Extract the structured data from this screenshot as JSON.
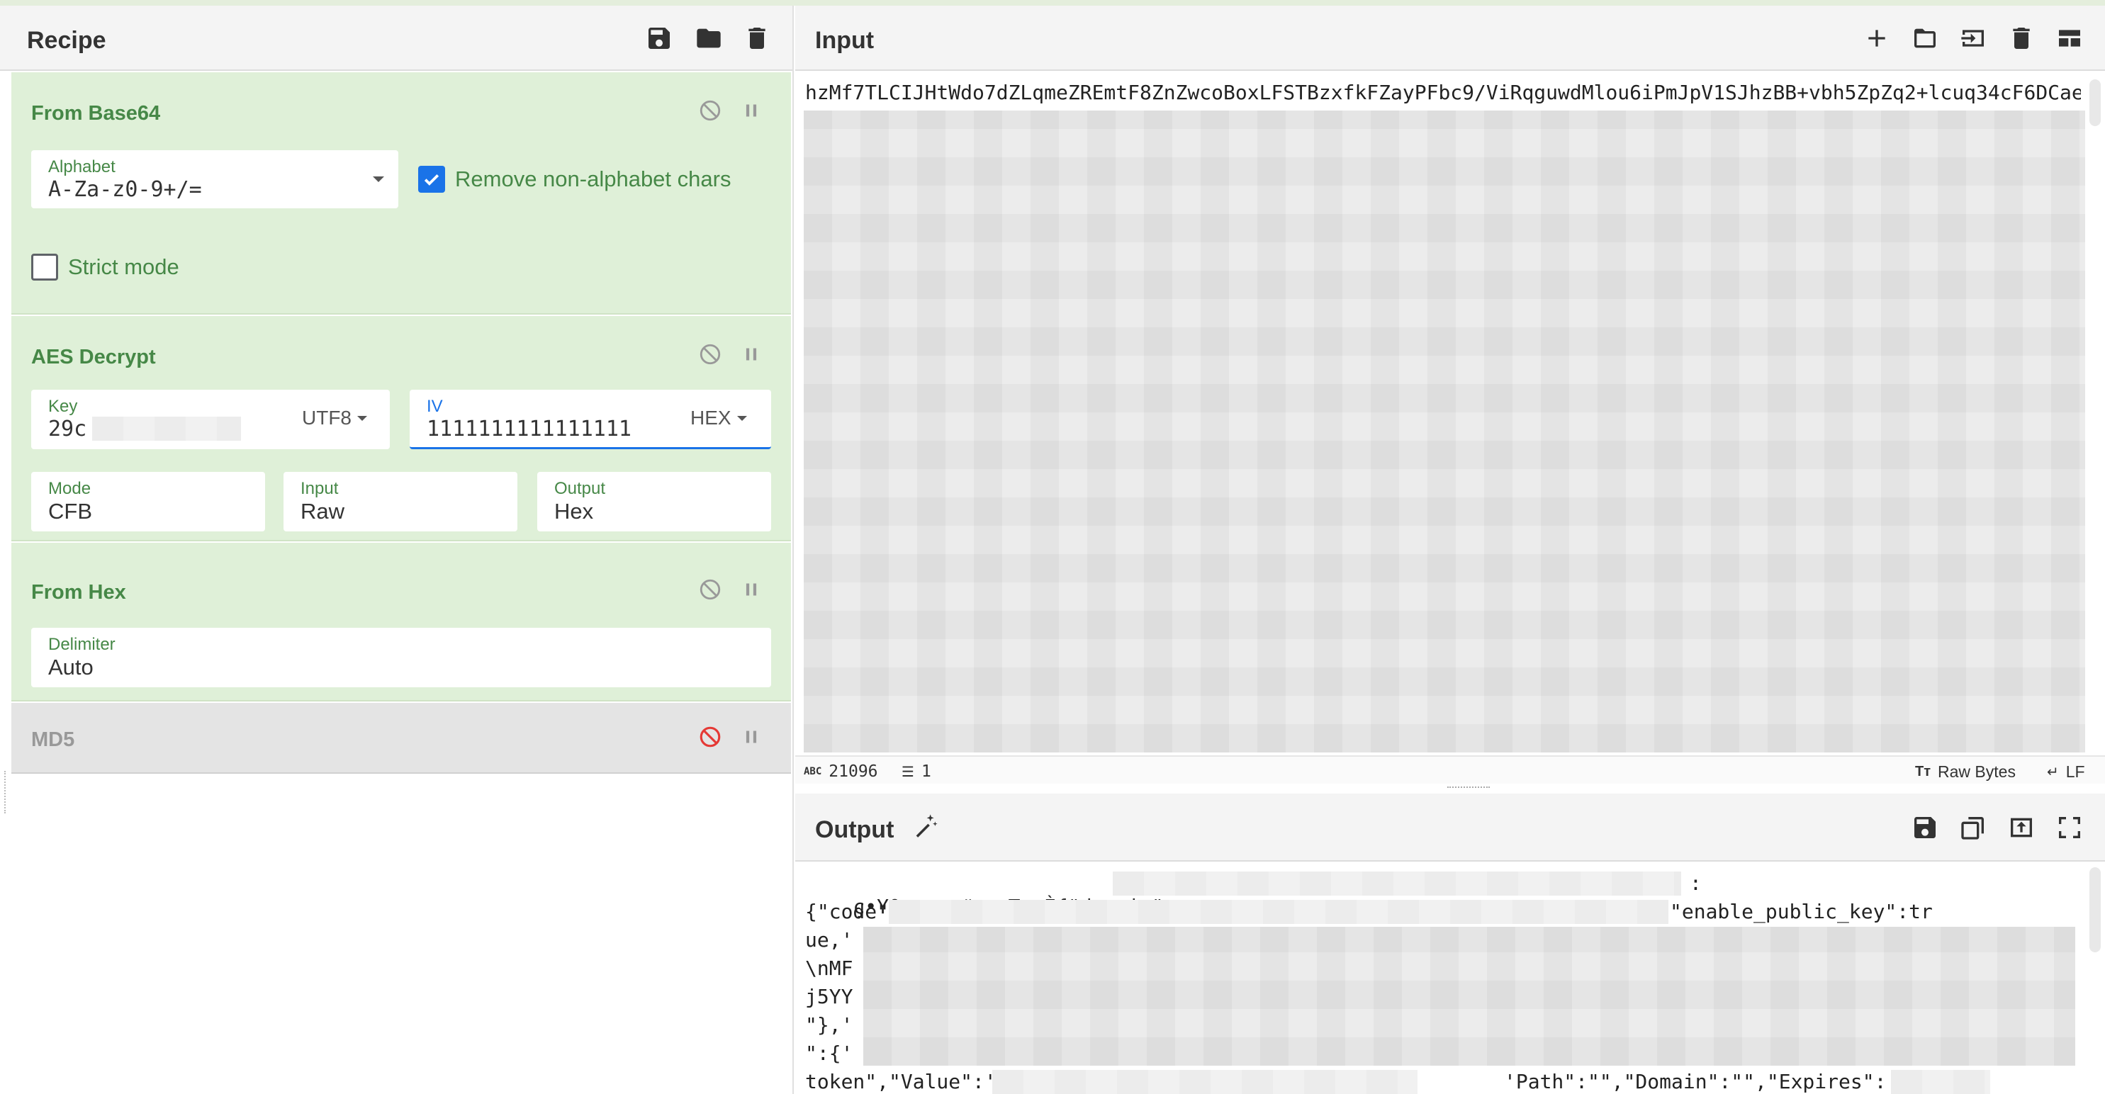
{
  "recipe": {
    "title": "Recipe",
    "icons": [
      "save-icon",
      "folder-icon",
      "trash-icon"
    ],
    "operations": {
      "from_base64": {
        "title": "From Base64",
        "alphabet_label": "Alphabet",
        "alphabet_value": "A-Za-z0-9+/=",
        "remove_nonalpha_label": "Remove non-alphabet chars",
        "remove_nonalpha_checked": true,
        "strict_mode_label": "Strict mode",
        "strict_mode_checked": false
      },
      "aes_decrypt": {
        "title": "AES Decrypt",
        "key_label": "Key",
        "key_value": "29c",
        "key_encoding": "UTF8",
        "iv_label": "IV",
        "iv_value": "1111111111111111",
        "iv_encoding": "HEX",
        "mode_label": "Mode",
        "mode_value": "CFB",
        "input_label": "Input",
        "input_value": "Raw",
        "output_label": "Output",
        "output_value": "Hex"
      },
      "from_hex": {
        "title": "From Hex",
        "delimiter_label": "Delimiter",
        "delimiter_value": "Auto"
      },
      "md5": {
        "title": "MD5",
        "disabled": true
      }
    }
  },
  "input": {
    "title": "Input",
    "first_line": "hzMf7TLCIJHtWdo7dZLqmeZREmtF8ZnZwcoBoxLFSTBzxfkFZayPFbc9/ViRqguwdMlou6iPmJpV1SJhzBB+vbh5ZpZq2+lcuq34cF6DCae",
    "status": {
      "length_icon": "abc-icon",
      "length": "21096",
      "lines_icon": "lines-icon",
      "lines": "1",
      "encoding": "Raw Bytes",
      "eol": "LF"
    }
  },
  "output": {
    "title": "Output",
    "lines": {
      "l1_prefix": "ç•Y0µ«»«ø#ræ•T",
      "l1_suffix": "È{\"domain\"",
      "l1_colon": ":",
      "l2_prefix": "{\"code\":",
      "l2_suffix": "\"enable_public_key\":tr",
      "l3_prefix": "ue,'",
      "l4_prefix": "\\nMF",
      "l5_prefix": "j5YY",
      "l6_prefix": "\"},'",
      "l7_prefix": "\":{'",
      "l8_a": "token\",\"Value\":'",
      "l8_b": "'Path\":\"\",\"Domain\":\"\",\"Expires\":'"
    }
  },
  "colors": {
    "op_bg": "#dff0d8",
    "op_title": "#468847",
    "disabled_bg": "#e4e4e4",
    "accent": "#1a73e8",
    "disable_icon_red": "#e53935"
  }
}
